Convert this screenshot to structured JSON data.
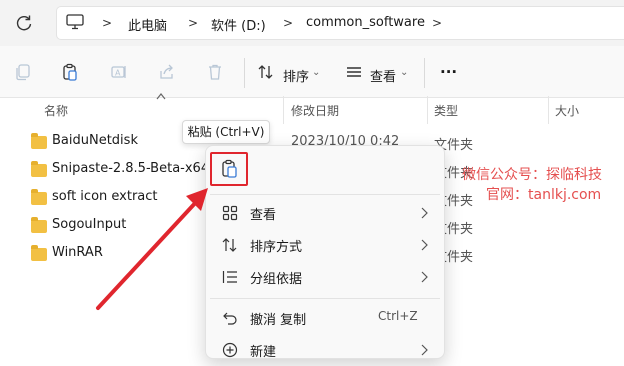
{
  "address": {
    "crumbs": [
      "此电脑",
      "软件 (D:)",
      "common_software"
    ],
    "separator": ">"
  },
  "toolbar": {
    "sort_label": "排序",
    "view_label": "查看",
    "more_label": "···",
    "dropdown_glyph": "⌄"
  },
  "columns": {
    "name": "名称",
    "modified": "修改日期",
    "type": "类型",
    "size": "大小"
  },
  "files": [
    {
      "name": "BaiduNetdisk",
      "modified": "2023/10/10 0:42",
      "type": "文件夹"
    },
    {
      "name": "Snipaste-2.8.5-Beta-x64",
      "modified": "",
      "type": "文件夹"
    },
    {
      "name": "soft icon extract",
      "modified": "",
      "type": "文件夹"
    },
    {
      "name": "SogouInput",
      "modified": "",
      "type": "文件夹"
    },
    {
      "name": "WinRAR",
      "modified": "",
      "type": "文件夹"
    }
  ],
  "tooltip": "粘贴 (Ctrl+V)",
  "context_menu": {
    "items": [
      {
        "label": "查看",
        "icon": "grid-icon",
        "submenu": true
      },
      {
        "label": "排序方式",
        "icon": "sort-icon",
        "submenu": true
      },
      {
        "label": "分组依据",
        "icon": "group-icon",
        "submenu": true
      },
      {
        "label": "撤消 复制",
        "icon": "undo-icon",
        "shortcut": "Ctrl+Z"
      },
      {
        "label": "新建",
        "icon": "new-icon",
        "submenu": true
      }
    ]
  },
  "watermark": {
    "line1": "微信公众号：探临科技",
    "line2": "官网：tanlkj.com"
  },
  "colors": {
    "highlight": "#e0262e",
    "folder": "#f2c043",
    "watermark": "#e55050"
  }
}
